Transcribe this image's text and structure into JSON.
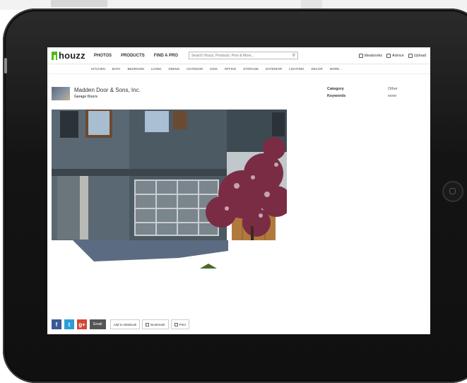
{
  "header": {
    "logo_text": "houzz",
    "nav": [
      "PHOTOS",
      "PRODUCTS",
      "FIND A PRO"
    ],
    "search_placeholder": "Search Houzz, Products, Pros & More...",
    "links": [
      "Ideabooks",
      "Advice",
      "Upload"
    ]
  },
  "subnav": [
    "KITCHEN",
    "BATH",
    "BEDROOM",
    "LIVING",
    "DINING",
    "OUTDOOR",
    "KIDS",
    "OFFICE",
    "STORAGE",
    "EXTERIOR",
    "LIGHTING",
    "DECOR",
    "MORE..."
  ],
  "profile": {
    "name": "Madden Door & Sons, Inc.",
    "category": "Garage Doors"
  },
  "meta": [
    {
      "key": "Category",
      "value": "Other"
    },
    {
      "key": "Keywords",
      "value": "none"
    }
  ],
  "share": {
    "facebook": "f",
    "twitter": "t",
    "googleplus": "g+",
    "email": "Email",
    "actions": [
      "Add to Ideabook",
      "Bookmark",
      "Print"
    ]
  },
  "colors": {
    "brand_green": "#4dbc15",
    "facebook": "#3b5998",
    "twitter": "#2a9fd6",
    "googleplus": "#d34836"
  }
}
